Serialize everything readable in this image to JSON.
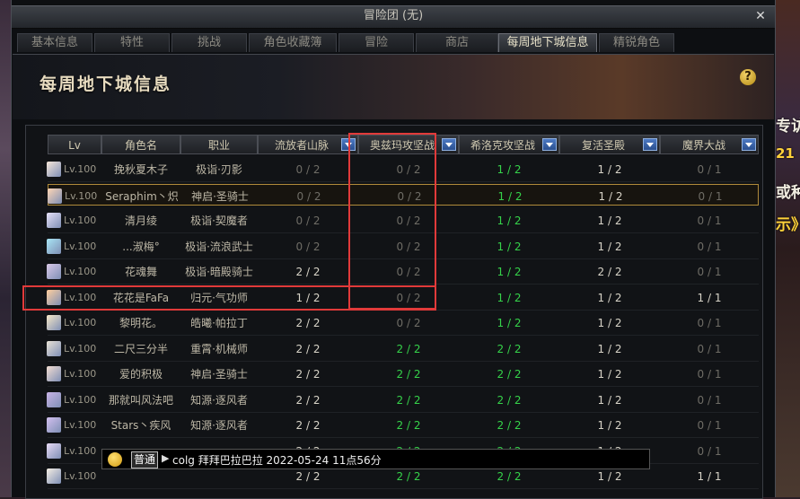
{
  "window": {
    "title": "冒险团 (无)",
    "close": "✕"
  },
  "tabs": [
    "基本信息",
    "特性",
    "挑战",
    "角色收藏簿",
    "冒险",
    "商店",
    "每周地下城信息",
    "精锐角色"
  ],
  "active_tab": 6,
  "banner": {
    "title": "每周地下城信息",
    "help": "?"
  },
  "columns": [
    "Lv",
    "角色名",
    "职业",
    "流放者山脉",
    "奥兹玛攻坚战",
    "希洛克攻坚战",
    "复活圣殿",
    "魔界大战"
  ],
  "rows": [
    {
      "lv": "Lv.100",
      "name": "挽秋夏木子",
      "job": "极诣·刃影",
      "c1": "0 / 2",
      "c2": "0 / 2",
      "c3": "1 / 2",
      "c4": "1 / 2",
      "c5": "0 / 1"
    },
    {
      "lv": "Lv.100",
      "name": "Seraphim丶炽",
      "job": "神启·圣骑士",
      "c1": "0 / 2",
      "c2": "0 / 2",
      "c3": "1 / 2",
      "c4": "1 / 2",
      "c5": "0 / 1"
    },
    {
      "lv": "Lv.100",
      "name": "清月绫",
      "job": "极诣·契魔者",
      "c1": "0 / 2",
      "c2": "0 / 2",
      "c3": "1 / 2",
      "c4": "1 / 2",
      "c5": "0 / 1"
    },
    {
      "lv": "Lv.100",
      "name": "...淑梅°",
      "job": "极诣·流浪武士",
      "c1": "0 / 2",
      "c2": "0 / 2",
      "c3": "1 / 2",
      "c4": "1 / 2",
      "c5": "0 / 1"
    },
    {
      "lv": "Lv.100",
      "name": "花魂舞",
      "job": "极诣·暗殿骑士",
      "c1": "2 / 2",
      "c2": "0 / 2",
      "c3": "1 / 2",
      "c4": "2 / 2",
      "c5": "0 / 1"
    },
    {
      "lv": "Lv.100",
      "name": "花花是FaFa",
      "job": "归元·气功师",
      "c1": "1 / 2",
      "c2": "0 / 2",
      "c3": "1 / 2",
      "c4": "1 / 2",
      "c5": "1 / 1"
    },
    {
      "lv": "Lv.100",
      "name": "黎明花。",
      "job": "皓曦·帕拉丁",
      "c1": "2 / 2",
      "c2": "0 / 2",
      "c3": "1 / 2",
      "c4": "1 / 2",
      "c5": "0 / 1"
    },
    {
      "lv": "Lv.100",
      "name": "二尺三分半",
      "job": "重霄·机械师",
      "c1": "2 / 2",
      "c2": "2 / 2",
      "c3": "2 / 2",
      "c4": "1 / 2",
      "c5": "0 / 1"
    },
    {
      "lv": "Lv.100",
      "name": "爱的积极",
      "job": "神启·圣骑士",
      "c1": "2 / 2",
      "c2": "2 / 2",
      "c3": "2 / 2",
      "c4": "1 / 2",
      "c5": "0 / 1"
    },
    {
      "lv": "Lv.100",
      "name": "那就叫风法吧",
      "job": "知源·逐风者",
      "c1": "2 / 2",
      "c2": "2 / 2",
      "c3": "2 / 2",
      "c4": "1 / 2",
      "c5": "0 / 1"
    },
    {
      "lv": "Lv.100",
      "name": "Stars丶疾风",
      "job": "知源·逐风者",
      "c1": "2 / 2",
      "c2": "2 / 2",
      "c3": "2 / 2",
      "c4": "1 / 2",
      "c5": "0 / 1"
    },
    {
      "lv": "Lv.100",
      "name": "",
      "job": "",
      "c1": "2 / 2",
      "c2": "2 / 2",
      "c3": "2 / 2",
      "c4": "1 / 2",
      "c5": "0 / 1"
    },
    {
      "lv": "Lv.100",
      "name": "",
      "job": "",
      "c1": "2 / 2",
      "c2": "2 / 2",
      "c3": "2 / 2",
      "c4": "1 / 2",
      "c5": "1 / 1"
    }
  ],
  "chat": {
    "channel": "普通",
    "message": "colg 拜拜巴拉巴拉 2022-05-24 11点56分"
  },
  "edge_right": [
    "专访",
    "21",
    "或种",
    "示》"
  ]
}
